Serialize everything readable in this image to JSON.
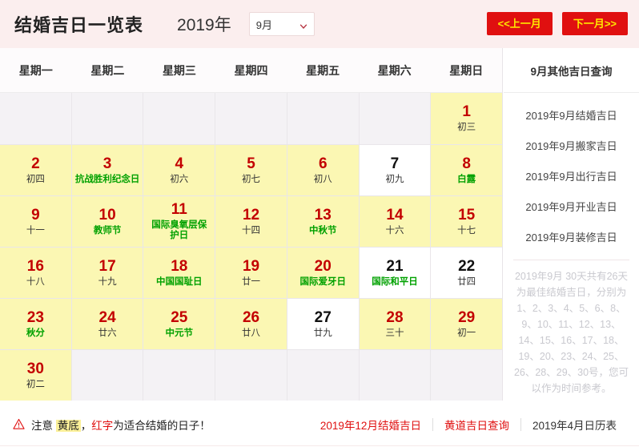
{
  "header": {
    "title": "结婚吉日一览表",
    "year": "2019年",
    "month_selected": "9月",
    "prev_label": "<<上一月",
    "next_label": "下一月>>"
  },
  "calendar": {
    "weekdays": [
      "星期一",
      "星期二",
      "星期三",
      "星期四",
      "星期五",
      "星期六",
      "星期日"
    ],
    "rows": [
      [
        {
          "type": "empty"
        },
        {
          "type": "empty"
        },
        {
          "type": "empty"
        },
        {
          "type": "empty"
        },
        {
          "type": "empty"
        },
        {
          "type": "empty"
        },
        {
          "type": "lucky",
          "day": "1",
          "sub": "初三",
          "fest": false
        }
      ],
      [
        {
          "type": "lucky",
          "day": "2",
          "sub": "初四",
          "fest": false
        },
        {
          "type": "lucky",
          "day": "3",
          "sub": "抗战胜利纪念日",
          "fest": true
        },
        {
          "type": "lucky",
          "day": "4",
          "sub": "初六",
          "fest": false
        },
        {
          "type": "lucky",
          "day": "5",
          "sub": "初七",
          "fest": false
        },
        {
          "type": "lucky",
          "day": "6",
          "sub": "初八",
          "fest": false
        },
        {
          "type": "plain",
          "day": "7",
          "sub": "初九",
          "fest": false
        },
        {
          "type": "lucky",
          "day": "8",
          "sub": "白露",
          "fest": true
        }
      ],
      [
        {
          "type": "lucky",
          "day": "9",
          "sub": "十一",
          "fest": false
        },
        {
          "type": "lucky",
          "day": "10",
          "sub": "教师节",
          "fest": true
        },
        {
          "type": "lucky",
          "day": "11",
          "sub": "国际臭氧层保护日",
          "fest": true,
          "wrap": true
        },
        {
          "type": "lucky",
          "day": "12",
          "sub": "十四",
          "fest": false
        },
        {
          "type": "lucky",
          "day": "13",
          "sub": "中秋节",
          "fest": true
        },
        {
          "type": "lucky",
          "day": "14",
          "sub": "十六",
          "fest": false
        },
        {
          "type": "lucky",
          "day": "15",
          "sub": "十七",
          "fest": false
        }
      ],
      [
        {
          "type": "lucky",
          "day": "16",
          "sub": "十八",
          "fest": false
        },
        {
          "type": "lucky",
          "day": "17",
          "sub": "十九",
          "fest": false
        },
        {
          "type": "lucky",
          "day": "18",
          "sub": "中国国耻日",
          "fest": true
        },
        {
          "type": "lucky",
          "day": "19",
          "sub": "廿一",
          "fest": false
        },
        {
          "type": "lucky",
          "day": "20",
          "sub": "国际爱牙日",
          "fest": true
        },
        {
          "type": "plain",
          "day": "21",
          "sub": "国际和平日",
          "fest": true
        },
        {
          "type": "plain",
          "day": "22",
          "sub": "廿四",
          "fest": false
        }
      ],
      [
        {
          "type": "lucky",
          "day": "23",
          "sub": "秋分",
          "fest": true
        },
        {
          "type": "lucky",
          "day": "24",
          "sub": "廿六",
          "fest": false
        },
        {
          "type": "lucky",
          "day": "25",
          "sub": "中元节",
          "fest": true
        },
        {
          "type": "lucky",
          "day": "26",
          "sub": "廿八",
          "fest": false
        },
        {
          "type": "plain",
          "day": "27",
          "sub": "廿九",
          "fest": false
        },
        {
          "type": "lucky",
          "day": "28",
          "sub": "三十",
          "fest": false
        },
        {
          "type": "lucky",
          "day": "29",
          "sub": "初一",
          "fest": false
        }
      ],
      [
        {
          "type": "lucky",
          "day": "30",
          "sub": "初二",
          "fest": false
        },
        {
          "type": "empty"
        },
        {
          "type": "empty"
        },
        {
          "type": "empty"
        },
        {
          "type": "empty"
        },
        {
          "type": "empty"
        },
        {
          "type": "empty"
        }
      ]
    ]
  },
  "sidebar": {
    "heading": "9月其他吉日查询",
    "links": [
      "2019年9月结婚吉日",
      "2019年9月搬家吉日",
      "2019年9月出行吉日",
      "2019年9月开业吉日",
      "2019年9月装修吉日"
    ],
    "note": "2019年9月 30天共有26天为最佳结婚吉日，分别为1、2、3、4、5、6、8、9、10、11、12、13、14、15、16、17、18、19、20、23、24、25、26、28、29、30号，您可以作为时间参考。"
  },
  "footer": {
    "notice_prefix": "注意",
    "notice_yellow": "黄底",
    "notice_comma": "，",
    "notice_red": "红字",
    "notice_suffix": "为适合结婚的日子！",
    "links": [
      {
        "label": "2019年12月结婚吉日",
        "style": "red"
      },
      {
        "label": "黄道吉日查询",
        "style": "red"
      },
      {
        "label": "2019年4月日历表",
        "style": "dark"
      }
    ]
  },
  "colors": {
    "brand_red": "#e01010",
    "lucky_bg": "#fbf7b3",
    "festival_green": "#00a100",
    "header_bg": "#fbeeee"
  }
}
